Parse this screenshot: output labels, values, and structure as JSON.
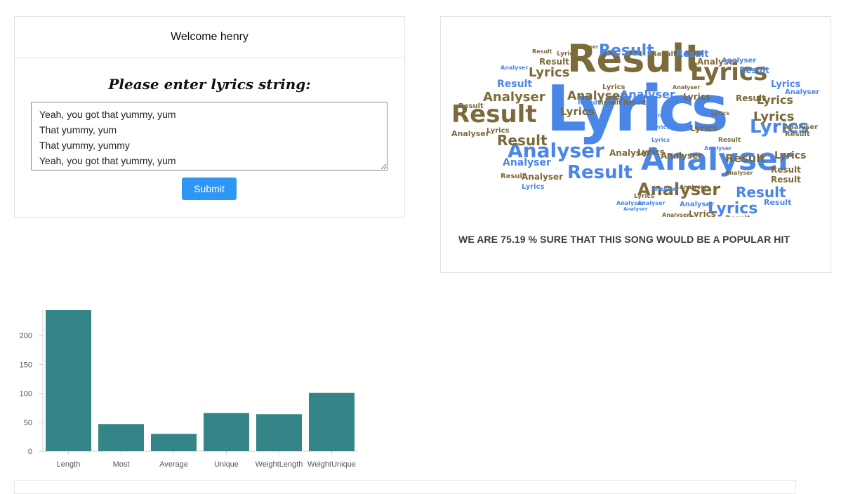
{
  "header": {
    "welcome": "Welcome henry"
  },
  "form": {
    "prompt": "Please enter lyrics string:",
    "lyrics_value": "Yeah, you got that yummy, yum\nThat yummy, yum\nThat yummy, yummy\nYeah, you got that yummy, yum",
    "submit_label": "Submit"
  },
  "wordcloud": {
    "words": [
      "Lyrics",
      "Analyser",
      "Result"
    ],
    "colors": {
      "blue": "#4a86e8",
      "brown": "#7d6a3a",
      "tan": "#a68c54"
    }
  },
  "prediction": {
    "text": "WE ARE 75.19 % SURE THAT THIS SONG WOULD BE A POPULAR HIT"
  },
  "chart_data": {
    "type": "bar",
    "categories": [
      "Length",
      "Most",
      "Average",
      "Unique",
      "WeightLength",
      "WeightUnique"
    ],
    "values": [
      244,
      47,
      30,
      66,
      64,
      101
    ],
    "ylim": [
      0,
      244
    ],
    "yticks": [
      0,
      50,
      100,
      150,
      200
    ],
    "bar_color": "#358488",
    "grid": false
  }
}
